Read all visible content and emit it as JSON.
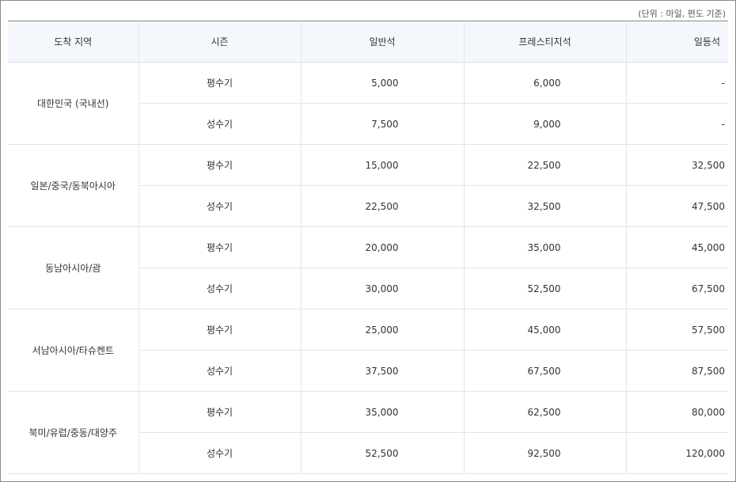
{
  "unit_note": "(단위 : 마일, 편도 기준)",
  "headers": {
    "region": "도착 지역",
    "season": "시즌",
    "economy": "일반석",
    "prestige": "프레스티지석",
    "first": "일등석"
  },
  "regions": [
    {
      "name": "대한민국 (국내선)",
      "rows": [
        {
          "season": "평수기",
          "economy": "5,000",
          "prestige": "6,000",
          "first": "-"
        },
        {
          "season": "성수기",
          "economy": "7,500",
          "prestige": "9,000",
          "first": "-"
        }
      ]
    },
    {
      "name": "일본/중국/동북아시아",
      "rows": [
        {
          "season": "평수기",
          "economy": "15,000",
          "prestige": "22,500",
          "first": "32,500"
        },
        {
          "season": "성수기",
          "economy": "22,500",
          "prestige": "32,500",
          "first": "47,500"
        }
      ]
    },
    {
      "name": "동남아시아/괌",
      "rows": [
        {
          "season": "평수기",
          "economy": "20,000",
          "prestige": "35,000",
          "first": "45,000"
        },
        {
          "season": "성수기",
          "economy": "30,000",
          "prestige": "52,500",
          "first": "67,500"
        }
      ]
    },
    {
      "name": "서남아시아/타슈켄트",
      "rows": [
        {
          "season": "평수기",
          "economy": "25,000",
          "prestige": "45,000",
          "first": "57,500"
        },
        {
          "season": "성수기",
          "economy": "37,500",
          "prestige": "67,500",
          "first": "87,500"
        }
      ]
    },
    {
      "name": "북미/유럽/중동/대양주",
      "rows": [
        {
          "season": "평수기",
          "economy": "35,000",
          "prestige": "62,500",
          "first": "80,000"
        },
        {
          "season": "성수기",
          "economy": "52,500",
          "prestige": "92,500",
          "first": "120,000"
        }
      ]
    }
  ]
}
